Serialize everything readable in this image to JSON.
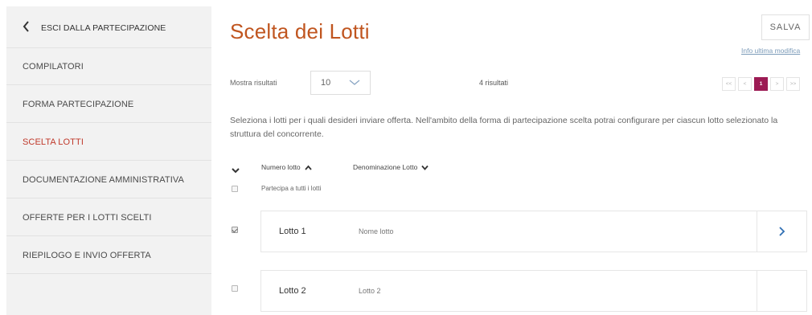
{
  "sidebar": {
    "exit_label": "ESCI DALLA PARTECIPAZIONE",
    "items": [
      {
        "label": "COMPILATORI",
        "active": false
      },
      {
        "label": "FORMA PARTECIPAZIONE",
        "active": false
      },
      {
        "label": "SCELTA LOTTI",
        "active": true
      },
      {
        "label": "DOCUMENTAZIONE AMMINISTRATIVA",
        "active": false
      },
      {
        "label": "OFFERTE PER I LOTTI SCELTI",
        "active": false
      },
      {
        "label": "RIEPILOGO E INVIO OFFERTA",
        "active": false
      }
    ]
  },
  "header": {
    "title": "Scelta dei Lotti",
    "save_label": "SALVA",
    "info_link": "Info ultima modifica"
  },
  "results": {
    "show_label": "Mostra risultati",
    "page_size": "10",
    "count_text": "4 risultati"
  },
  "pagination": {
    "first": "<<",
    "prev": "<",
    "current": "1",
    "next": ">",
    "last": ">>"
  },
  "description": "Seleziona i lotti per i quali desideri inviare offerta. Nell'ambito della forma di partecipazione scelta potrai configurare per ciascun lotto selezionato la struttura del concorrente.",
  "table": {
    "col_number": "Numero lotto",
    "col_name": "Denominazione Lotto",
    "select_all_label": "Partecipa a tutti i lotti",
    "select_all_checked": false,
    "rows": [
      {
        "name": "Lotto 1",
        "description": "Nome lotto",
        "checked": true
      },
      {
        "name": "Lotto 2",
        "description": "Lotto 2",
        "checked": false
      }
    ]
  },
  "colors": {
    "accent": "#c0551f",
    "active_nav": "#c0392b",
    "pagination_active": "#9c1b54",
    "link": "#7a9ab8",
    "sidebar_bg": "#f2f2f2"
  }
}
